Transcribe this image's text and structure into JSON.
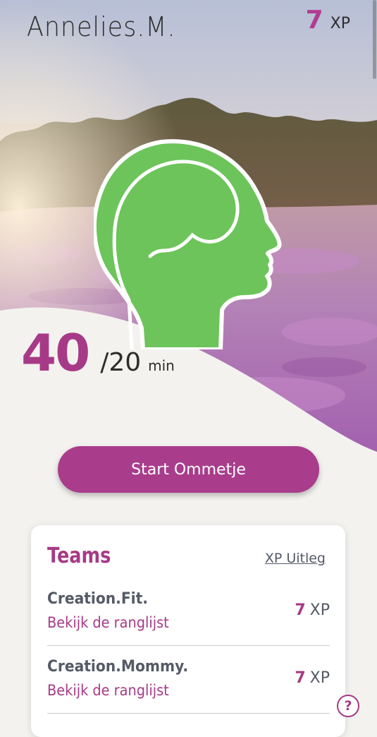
{
  "header": {
    "user_name": "Annelies.M.",
    "xp_value": "7",
    "xp_unit": "XP"
  },
  "progress": {
    "minutes_done": "40",
    "minutes_goal": "/20",
    "unit": "min"
  },
  "hero": {
    "icon": "head-brain-icon",
    "icon_color": "#6cc45a"
  },
  "actions": {
    "start_label": "Start Ommetje"
  },
  "teams": {
    "title": "Teams",
    "xp_explain_label": "XP Uitleg",
    "items": [
      {
        "name": "Creation.Fit.",
        "link_label": "Bekijk de ranglijst",
        "xp": "7",
        "xp_unit": "XP"
      },
      {
        "name": "Creation.Mommy.",
        "link_label": "Bekijk de ranglijst",
        "xp": "7",
        "xp_unit": "XP"
      }
    ]
  },
  "help": {
    "label": "?"
  },
  "colors": {
    "accent": "#a93d8c",
    "background": "#f3f2ef",
    "text_dark": "#2d2d2d",
    "text_muted": "#555a66"
  }
}
